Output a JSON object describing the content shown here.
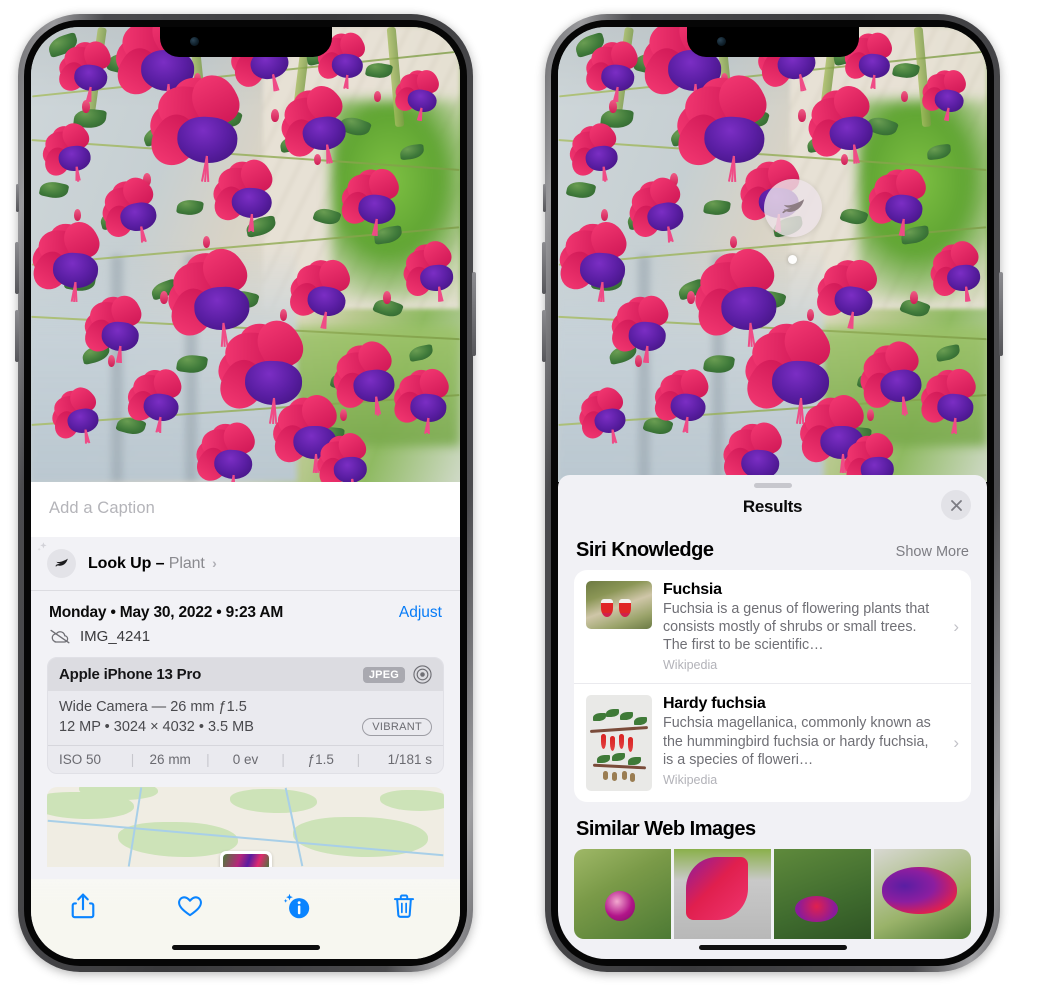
{
  "left_phone": {
    "caption_placeholder": "Add a Caption",
    "lookup": {
      "icon": "leaf-icon",
      "sparkle_icon": "sparkle-icon",
      "label": "Look Up –",
      "subject": "Plant",
      "chevron": "›"
    },
    "date_line": "Monday • May 30, 2022 • 9:23 AM",
    "adjust_label": "Adjust",
    "filename": "IMG_4241",
    "cloud_icon": "cloud-slash-icon",
    "exif": {
      "device": "Apple iPhone 13 Pro",
      "format_tag": "JPEG",
      "lens_icon": "aperture-icon",
      "lens_line": "Wide Camera — 26 mm ƒ1.5",
      "specs_line": "12 MP • 3024 × 4032 • 3.5 MB",
      "style_tag": "VIBRANT",
      "stats": [
        "ISO 50",
        "26 mm",
        "0 ev",
        "ƒ1.5",
        "1/181 s"
      ],
      "separator": "|"
    },
    "toolbar": [
      {
        "name": "share-icon",
        "label": "Share"
      },
      {
        "name": "heart-icon",
        "label": "Favorite"
      },
      {
        "name": "info-icon",
        "label": "Info"
      },
      {
        "name": "trash-icon",
        "label": "Delete"
      }
    ]
  },
  "right_phone": {
    "visual_lookup_badge": "leaf-icon",
    "sheet": {
      "title": "Results",
      "close_icon": "close-icon",
      "grabber": "drag-handle"
    },
    "siri_knowledge": {
      "title": "Siri Knowledge",
      "show_more": "Show More",
      "items": [
        {
          "title": "Fuchsia",
          "description": "Fuchsia is a genus of flowering plants that consists mostly of shrubs or small trees. The first to be scientific…",
          "source": "Wikipedia",
          "chevron": "›"
        },
        {
          "title": "Hardy fuchsia",
          "description": "Fuchsia magellanica, commonly known as the hummingbird fuchsia or hardy fuchsia, is a species of floweri…",
          "source": "Wikipedia",
          "chevron": "›"
        }
      ]
    },
    "similar_web_images": {
      "title": "Similar Web Images",
      "count": 4
    }
  },
  "colors": {
    "accent_blue": "#067bf7",
    "sheet_bg": "#f1f1f5",
    "info_bg": "#f2f2f6",
    "card_bg": "#ffffff",
    "muted_text": "#8a8a8f"
  }
}
